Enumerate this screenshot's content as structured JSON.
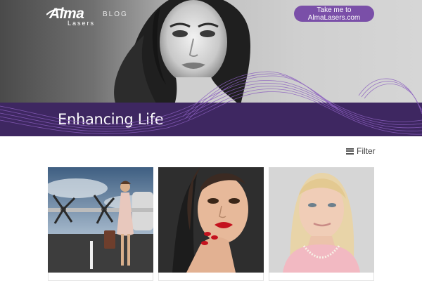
{
  "header": {
    "brand": "Alma",
    "brand_sub": "Lasers",
    "section": "BLOG",
    "cta_label": "Take me to AlmaLasers.com"
  },
  "banner": {
    "title": "Enhancing Life"
  },
  "filter": {
    "label": "Filter",
    "icon": "menu-icon"
  },
  "posts": [
    {
      "image": "woman-on-airfield-photo"
    },
    {
      "image": "woman-red-lips-photo"
    },
    {
      "image": "blonde-woman-pearls-photo"
    }
  ],
  "colors": {
    "banner": "#3e2761",
    "accent": "#7a4fa8",
    "waves": "#8b5fbf"
  }
}
